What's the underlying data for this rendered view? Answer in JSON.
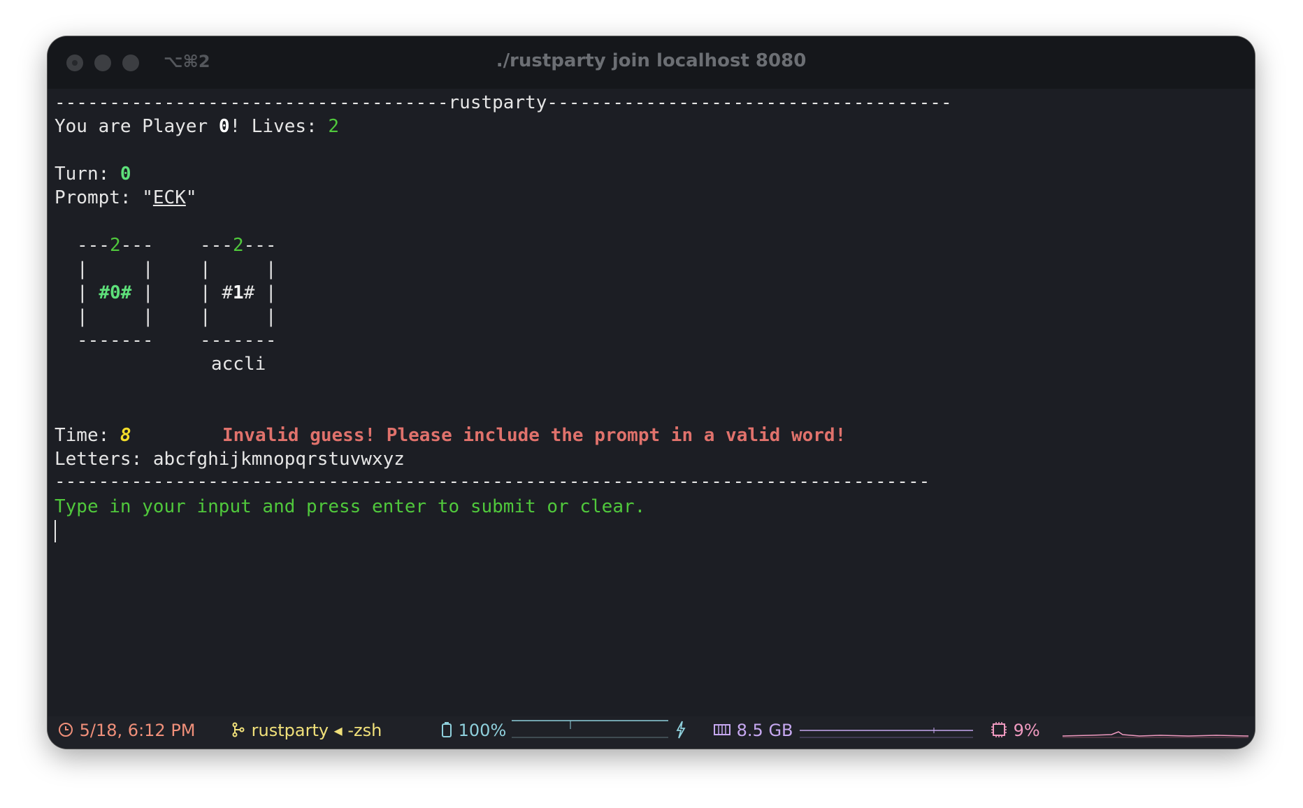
{
  "window": {
    "tab_shortcut": "⌥⌘2",
    "title": "./rustparty join localhost 8080"
  },
  "terminal": {
    "header_left": "------------------------------------",
    "header_title": "rustparty",
    "header_right": "-------------------------------------",
    "player_prefix": "You are Player ",
    "player_number": "0",
    "lives_label": "! Lives: ",
    "lives_value": "2",
    "turn_label": "Turn: ",
    "turn_value": "0",
    "prompt_label": "Prompt: \"",
    "prompt_value": "ECK",
    "prompt_close": "\"",
    "players": [
      {
        "lives_left": "---",
        "lives": "2",
        "lives_right": "---",
        "side": "|     |",
        "mid_left": "| ",
        "id_prefix": "#",
        "id": "0",
        "id_suffix": "#",
        "mid_right": " |",
        "bottom": "-------",
        "word": ""
      },
      {
        "lives_left": "---",
        "lives": "2",
        "lives_right": "---",
        "side": "|     |",
        "mid_left": "| ",
        "id_prefix": "#",
        "id": "1",
        "id_suffix": "#",
        "mid_right": " |",
        "bottom": "-------",
        "word": "accli"
      }
    ],
    "time_label": "Time: ",
    "time_value": "8",
    "error_message": "Invalid guess! Please include the prompt in a valid word!",
    "letters_label": "Letters: ",
    "letters_value": "abcfghijkmnopqrstuvwxyz",
    "separator": "--------------------------------------------------------------------------------",
    "instruction": "Type in your input and press enter to submit or clear."
  },
  "statusbar": {
    "datetime": "5/18, 6:12 PM",
    "directory": "rustparty ◂ -zsh",
    "battery": "100%",
    "memory": "8.5 GB",
    "cpu": "9%"
  },
  "colors": {
    "terminal_bg": "#1c1e24",
    "green": "#50c83c",
    "error_red": "#e0726c",
    "time_yellow": "#f2dc2a",
    "status_time": "#f0907a",
    "status_dir": "#f0e07a",
    "status_battery": "#8fd0dc",
    "status_memory": "#c6a8f0",
    "status_cpu": "#f09ac0"
  },
  "icons": {
    "traffic_lights": [
      "close-light",
      "minimize-light",
      "zoom-light"
    ],
    "status": [
      "clock-icon",
      "git-branch-icon",
      "battery-icon",
      "charging-bolt-icon",
      "memory-icon",
      "cpu-icon"
    ]
  }
}
